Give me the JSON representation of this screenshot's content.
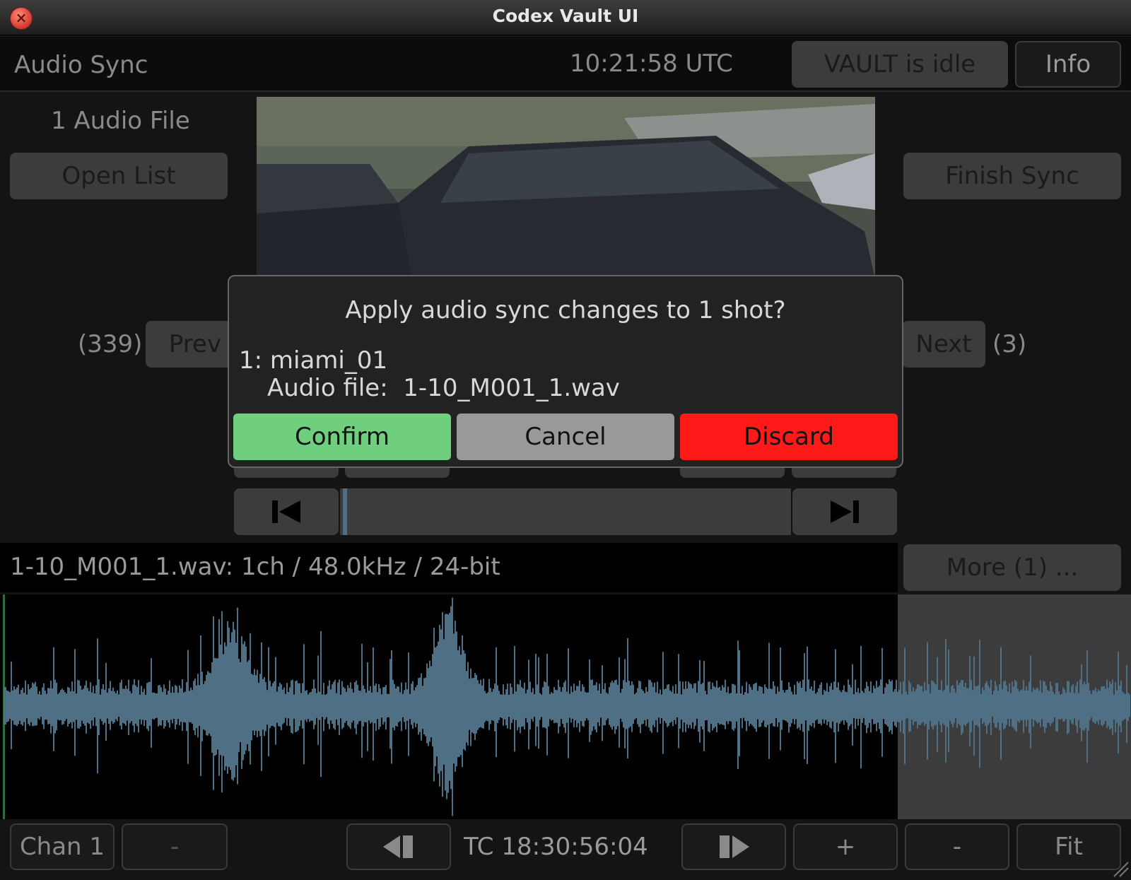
{
  "window": {
    "title": "Codex Vault UI"
  },
  "header": {
    "section": "Audio Sync",
    "clock": "10:21:58 UTC",
    "status": "VAULT is idle",
    "info_label": "Info"
  },
  "left_panel": {
    "audio_count": "1 Audio File",
    "open_list": "Open List",
    "prev_count": "(339)",
    "prev_label": "Prev"
  },
  "right_panel": {
    "finish_sync": "Finish Sync",
    "next_label": "Next",
    "next_count": "(3)"
  },
  "dialog": {
    "question": "Apply audio sync changes to 1 shot?",
    "shot_line": "1: miami_01",
    "audio_line": "Audio file:  1-10_M001_1.wav",
    "confirm": "Confirm",
    "cancel": "Cancel",
    "discard": "Discard",
    "colors": {
      "confirm": "#6fcf7f",
      "cancel": "#999999",
      "discard": "#ff1a1a"
    }
  },
  "transport": {
    "start_icon": "skip-to-start-icon",
    "end_icon": "skip-to-end-icon",
    "position": 0.0
  },
  "file_info": {
    "text": "1-10_M001_1.wav: 1ch / 48.0kHz / 24-bit",
    "more": "More (1) ..."
  },
  "waveform": {
    "color": "#4f6f85"
  },
  "bottom_bar": {
    "channel": "Chan 1",
    "minus_left": "-",
    "prev_frame_icon": "step-back-icon",
    "timecode": "TC 18:30:56:04",
    "next_frame_icon": "step-forward-icon",
    "plus": "+",
    "minus_right": "-",
    "fit": "Fit"
  }
}
